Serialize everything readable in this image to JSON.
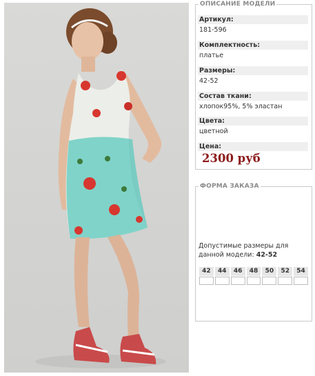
{
  "description": {
    "legend": "ОПИСАНИЕ МОДЕЛИ",
    "rows": [
      {
        "label": "Артикул:",
        "value": "181-596"
      },
      {
        "label": "Комплектность:",
        "value": "платье"
      },
      {
        "label": "Размеры:",
        "value": "42-52"
      },
      {
        "label": "Состав ткани:",
        "value": "хлопок95%, 5% эластан"
      },
      {
        "label": "Цвета:",
        "value": "цветной"
      },
      {
        "label": "Цена:",
        "value": ""
      }
    ],
    "price": "2300 руб"
  },
  "order": {
    "legend": "ФОРМА ЗАКАЗА",
    "sizes_text": "Допустимые размеры для данной модели:",
    "sizes_range": "42-52",
    "sizes": [
      "42",
      "44",
      "46",
      "48",
      "50",
      "52",
      "54"
    ]
  },
  "colors": {
    "price": "#8b1a1a",
    "panel_border": "#c9c9c9",
    "label_bg": "#efefef"
  }
}
